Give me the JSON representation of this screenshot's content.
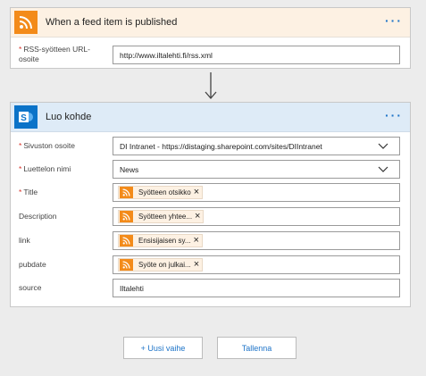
{
  "trigger": {
    "title": "When a feed item is published",
    "more": "···",
    "icon": "rss-icon",
    "fields": [
      {
        "label": "RSS-syötteen URL-osoite",
        "required": true,
        "value": "http://www.iltalehti.fi/rss.xml"
      }
    ]
  },
  "action": {
    "title": "Luo kohde",
    "more": "···",
    "icon": "sharepoint-icon",
    "fields": [
      {
        "label": "Sivuston osoite",
        "required": true,
        "value": "DI Intranet - https://distaging.sharepoint.com/sites/DIIntranet",
        "dropdown": true
      },
      {
        "label": "Luettelon nimi",
        "required": true,
        "value": "News",
        "dropdown": true
      },
      {
        "label": "Title",
        "required": true,
        "token": "Syötteen otsikko"
      },
      {
        "label": "Description",
        "required": false,
        "token": "Syötteen yhtee..."
      },
      {
        "label": "link",
        "required": false,
        "token": "Ensisijaisen sy..."
      },
      {
        "label": "pubdate",
        "required": false,
        "token": "Syöte on julkai..."
      },
      {
        "label": "source",
        "required": false,
        "value": "Iltalehti"
      }
    ]
  },
  "buttons": {
    "new_step": "+ Uusi vaihe",
    "save": "Tallenna"
  },
  "colors": {
    "rss": "#f38b1a",
    "sharepoint": "#0b73c8",
    "accent": "#1e74c8",
    "required": "#d9342b"
  }
}
